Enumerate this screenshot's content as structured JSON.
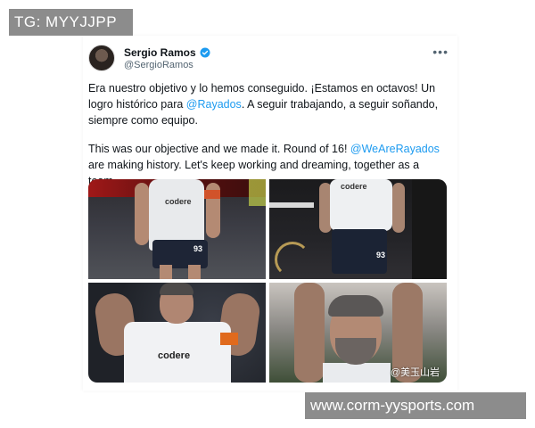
{
  "overlay": {
    "top_left": "TG: MYYJJPP",
    "bottom_right": "www.corm-yysports.com"
  },
  "tweet": {
    "author_name": "Sergio Ramos",
    "author_handle": "@SergioRamos",
    "verified": true,
    "more_icon": "more-dots-icon",
    "text_es_1": "Era nuestro objetivo y lo hemos conseguido. ¡Estamos en octavos! Un logro histórico para ",
    "mention_es": "@Rayados",
    "text_es_2": ". A seguir trabajando, a seguir soñando, siempre como equipo.",
    "text_en_1": "This was our objective and we made it. Round of 16! ",
    "mention_en": "@WeAreRayados",
    "text_en_2": " are making history. Let's keep working and dreaming, together as a team."
  },
  "photos": {
    "p1_logo": "codere",
    "p1_number": "93",
    "p2_logo": "codere",
    "p2_number": "93",
    "p3_logo": "codere",
    "p4_watermark": "@美玉山岩"
  },
  "colors": {
    "link": "#1d9bf0",
    "verified_badge": "#1d9bf0"
  }
}
